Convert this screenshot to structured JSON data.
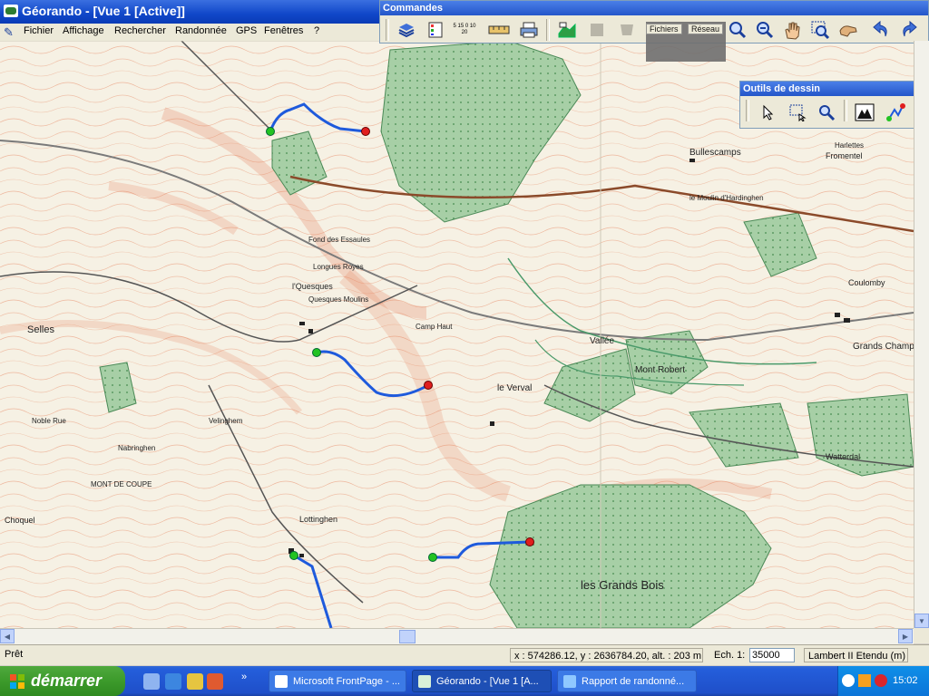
{
  "window": {
    "title": "Géorando - [Vue 1 [Active]]",
    "menu": [
      "Fichier",
      "Affichage",
      "Rechercher",
      "Randonnée",
      "GPS",
      "Fenêtres",
      "?"
    ]
  },
  "toolbars": {
    "commandes": {
      "title": "Commandes",
      "scale_icon_text": "5 15 0 10 20",
      "tab_fichiers": "Fichiers",
      "tab_reseau": "Réseau"
    },
    "dessin": {
      "title": "Outils de dessin"
    }
  },
  "map": {
    "labels": [
      "Longues Royes",
      "l'Quesques",
      "Selles",
      "Lottinghen",
      "Coulomby",
      "Grands Champs",
      "le Verval",
      "les Grands Bois",
      "Camp Haut",
      "Quesques Moulins",
      "le Moulin d'Hardinghen",
      "Bullescamps",
      "Fromentel",
      "Harlettes",
      "Vallée",
      "Mont Robert",
      "Watterdal",
      "MONT DE COUPE",
      "Choquel",
      "Velinghem",
      "Noble Rue",
      "Nabringhen",
      "Fond des Essaules"
    ],
    "colors": {
      "route": "#1e5adc",
      "start_point": "#22c322",
      "end_point": "#e01e1e",
      "forest": "#a7cfa6",
      "contour": "#e47752"
    }
  },
  "statusbar": {
    "ready": "Prêt",
    "coords": "x : 574286.12, y : 2636784.20, alt. : 203 m",
    "scale_label": "Ech. 1:",
    "scale_value": "35000",
    "projection": "Lambert II Etendu (m)"
  },
  "taskbar": {
    "start_label": "démarrer",
    "tasks": [
      "Microsoft FrontPage - ...",
      "Géorando - [Vue 1 [A...",
      "Rapport de randonné..."
    ],
    "clock": "15:02"
  }
}
